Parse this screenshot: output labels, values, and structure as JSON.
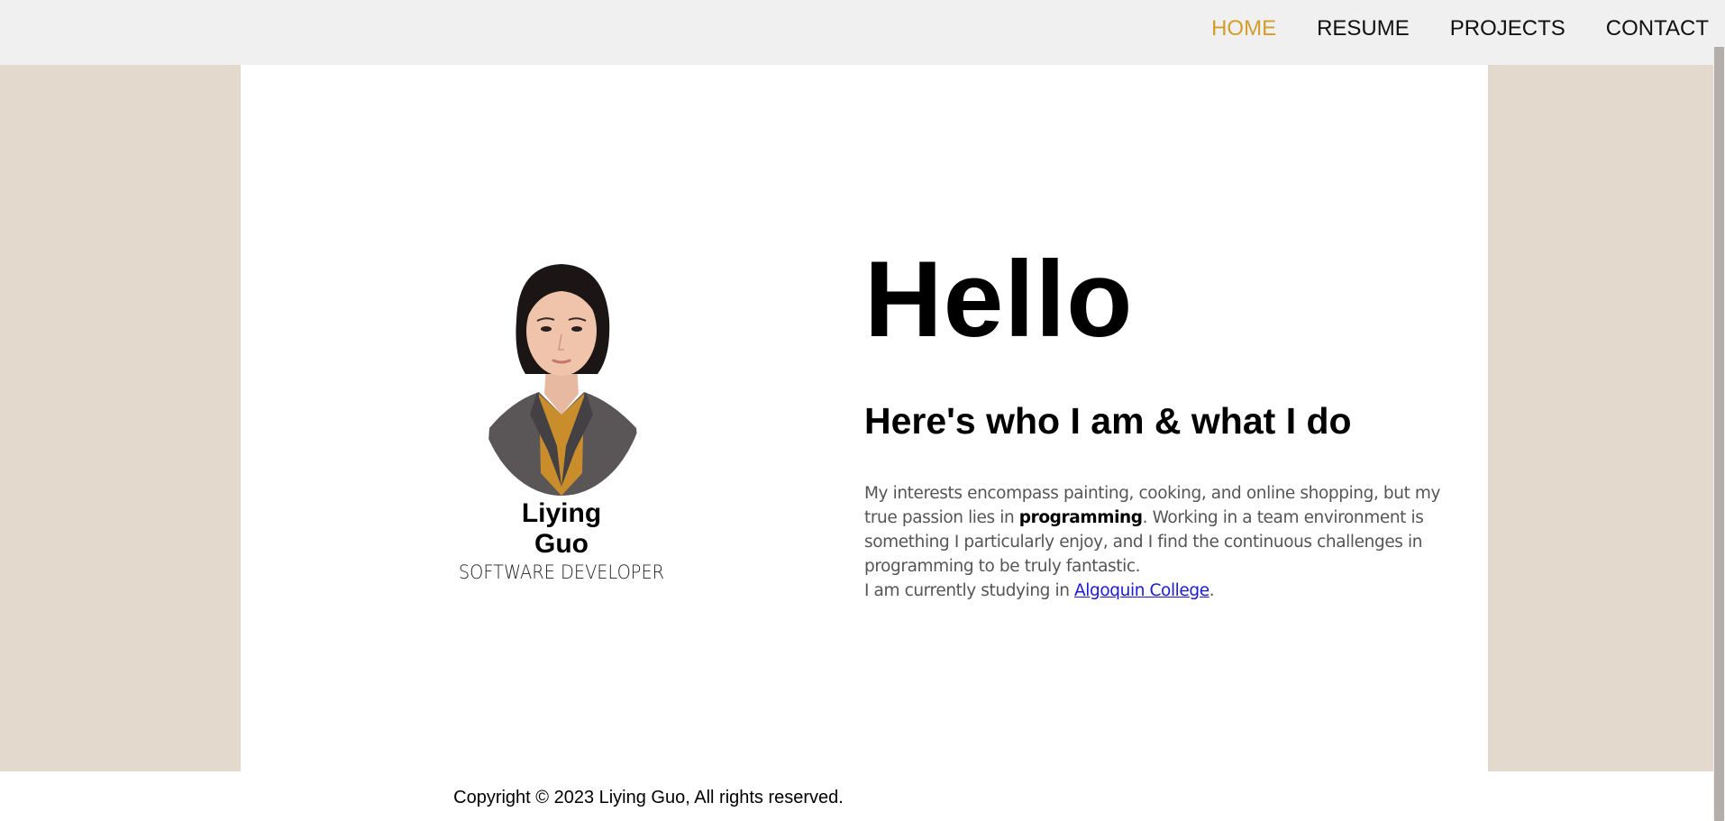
{
  "nav": {
    "items": [
      {
        "label": "HOME",
        "active": true
      },
      {
        "label": "RESUME",
        "active": false
      },
      {
        "label": "PROJECTS",
        "active": false
      },
      {
        "label": "CONTACT",
        "active": false
      }
    ],
    "active_color": "#d29d2a"
  },
  "profile": {
    "first_name": "Liying",
    "last_name": "Guo",
    "role": "SOFTWARE DEVELOPER",
    "photo_icon": "profile-photo"
  },
  "intro": {
    "greeting": "Hello",
    "subheading": "Here's who I am & what I do",
    "bio_part1": "My interests encompass painting, cooking, and online shopping, but my true passion lies in ",
    "bio_bold": "programming",
    "bio_part2": ". Working in a team environment is something I particularly enjoy, and I find the continuous challenges in programming to be truly fantastic.",
    "study_prefix": "I am currently studying in ",
    "college_link": "Algoquin College",
    "study_suffix": "."
  },
  "footer": {
    "copyright": "Copyright © 2023 Liying Guo, All rights reserved."
  },
  "colors": {
    "side_panel": "#e4d9cd",
    "topbar": "#f1f0f1",
    "link": "#1a1ad6"
  }
}
